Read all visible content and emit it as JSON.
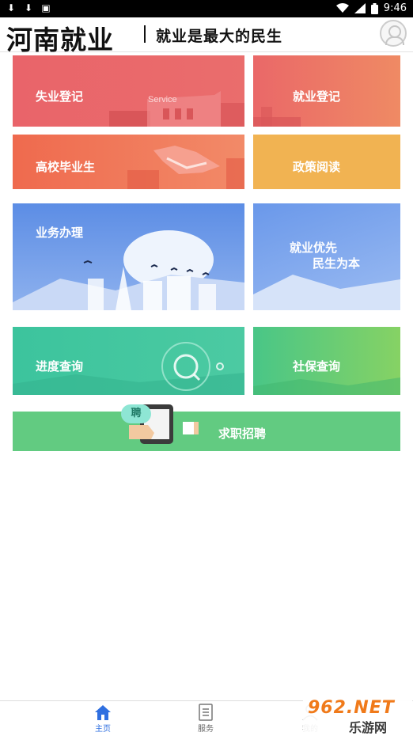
{
  "status_bar": {
    "time": "9:46"
  },
  "header": {
    "logo": "河南就业",
    "slogan": "就业是最大的民生"
  },
  "tiles": {
    "unemployment": {
      "label": "失业登记",
      "sign": "Service"
    },
    "employment": {
      "label": "就业登记"
    },
    "graduates": {
      "label": "高校毕业生"
    },
    "policy": {
      "label": "政策阅读"
    },
    "business": {
      "label": "业务办理"
    },
    "priority": {
      "line1": "就业优先",
      "line2": "民生为本"
    },
    "progress": {
      "label": "进度查询"
    },
    "social": {
      "label": "社保查询"
    },
    "recruit": {
      "label": "求职招聘",
      "badge": "聘"
    }
  },
  "tabbar": {
    "tabs": [
      {
        "label": "主页",
        "icon": "home-icon",
        "active": true
      },
      {
        "label": "服务",
        "icon": "document-icon",
        "active": false
      },
      {
        "label": "我的",
        "icon": "user-icon",
        "active": false
      }
    ]
  },
  "watermark": {
    "brand": "962.NET",
    "text": "乐游网"
  },
  "colors": {
    "accent": "#2f6fe0",
    "red": "#e75e62",
    "orange": "#f0a53a",
    "blue": "#5b8ee6",
    "green": "#3cc49a"
  }
}
